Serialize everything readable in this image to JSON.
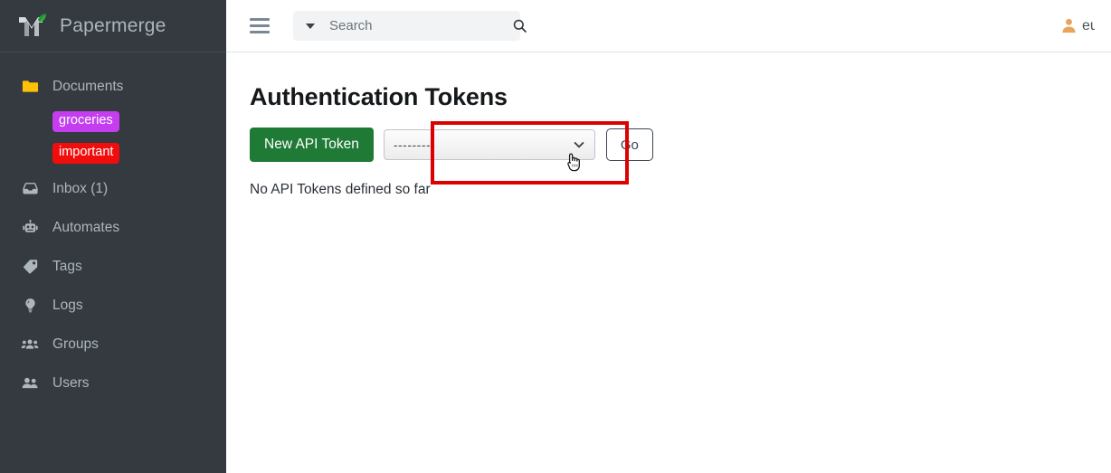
{
  "brand": {
    "name": "Papermerge",
    "logo_icon": "papermerge-m-leaf-logo"
  },
  "sidebar": {
    "items": [
      {
        "label": "Documents",
        "icon": "folder-icon"
      },
      {
        "label": "Inbox (1)",
        "icon": "inbox-icon"
      },
      {
        "label": "Automates",
        "icon": "robot-icon"
      },
      {
        "label": "Tags",
        "icon": "tag-icon"
      },
      {
        "label": "Logs",
        "icon": "lightbulb-icon"
      },
      {
        "label": "Groups",
        "icon": "groups-icon"
      },
      {
        "label": "Users",
        "icon": "users-icon"
      }
    ],
    "tags": [
      {
        "label": "groceries",
        "color": "#c43ef0"
      },
      {
        "label": "important",
        "color": "#f20d0d"
      }
    ],
    "background_color": "#343a40",
    "text_color": "#adb5bd"
  },
  "topbar": {
    "menu_icon": "hamburger-icon",
    "search": {
      "placeholder": "Search",
      "value": "",
      "caret_icon": "caret-down-icon",
      "submit_icon": "search-icon"
    },
    "user": {
      "name": "eu",
      "icon": "user-avatar-icon"
    }
  },
  "content": {
    "page_title": "Authentication Tokens",
    "new_token_button": "New API Token",
    "token_select": {
      "selected": "---------",
      "chevron_icon": "chevron-down-icon"
    },
    "go_button": "Go",
    "empty_message": "No API Tokens defined so far"
  },
  "annotations": {
    "highlight_color": "#dd0000",
    "cursor_icon": "pointing-hand-cursor"
  }
}
